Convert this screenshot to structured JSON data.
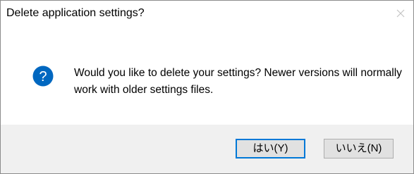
{
  "window": {
    "title": "Delete application settings?",
    "close_icon": "close-icon"
  },
  "message": {
    "icon": "question-icon",
    "icon_color": "#0067c0",
    "text": "Would you like to delete your settings? Newer versions will normally work with older settings files."
  },
  "buttons": {
    "yes_label": "はい(Y)",
    "no_label": "いいえ(N)",
    "accent_color": "#0078d7"
  }
}
